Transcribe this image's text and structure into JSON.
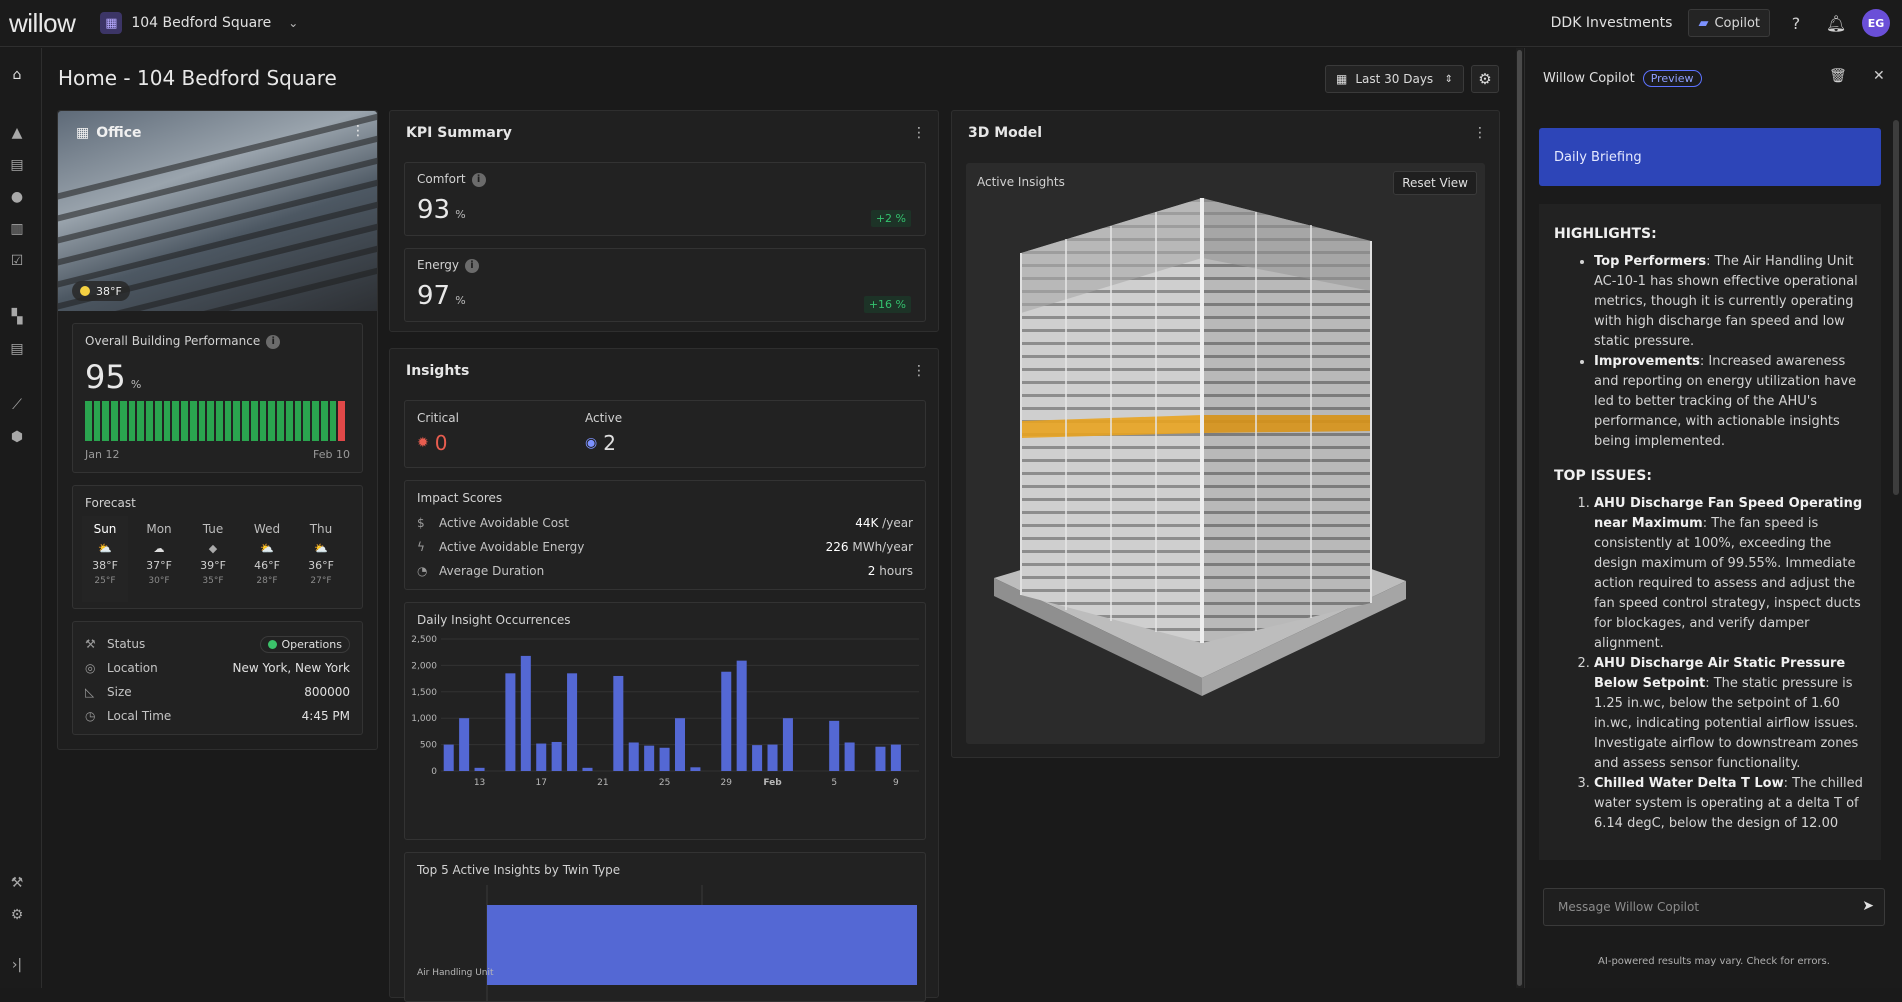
{
  "topbar": {
    "logo": "willow",
    "site_name": "104 Bedford Square",
    "org_name": "DDK Investments",
    "copilot_label": "Copilot",
    "avatar_initials": "EG"
  },
  "page": {
    "title": "Home - 104 Bedford Square",
    "date_range": "Last 30 Days"
  },
  "building": {
    "type_label": "Office",
    "temperature": "38°F",
    "performance_label": "Overall Building Performance",
    "performance_value": "95",
    "performance_unit": "%",
    "start_date": "Jan 12",
    "end_date": "Feb 10",
    "forecast_label": "Forecast",
    "forecast": [
      {
        "day": "Sun",
        "weather": "⛅",
        "hi": "38°F",
        "lo": "25°F"
      },
      {
        "day": "Mon",
        "weather": "☁",
        "hi": "37°F",
        "lo": "30°F"
      },
      {
        "day": "Tue",
        "weather": "◆",
        "hi": "39°F",
        "lo": "35°F"
      },
      {
        "day": "Wed",
        "weather": "⛅",
        "hi": "46°F",
        "lo": "28°F"
      },
      {
        "day": "Thu",
        "weather": "⛅",
        "hi": "36°F",
        "lo": "27°F"
      }
    ],
    "details": {
      "status_label": "Status",
      "status_value": "Operations",
      "location_label": "Location",
      "location_value": "New York, New York",
      "size_label": "Size",
      "size_value": "800000",
      "time_label": "Local Time",
      "time_value": "4:45 PM"
    }
  },
  "kpi": {
    "title": "KPI Summary",
    "comfort_label": "Comfort",
    "comfort_value": "93",
    "comfort_unit": "%",
    "comfort_delta": "+2 %",
    "energy_label": "Energy",
    "energy_value": "97",
    "energy_unit": "%",
    "energy_delta": "+16 %"
  },
  "insights": {
    "title": "Insights",
    "critical_label": "Critical",
    "critical_value": "0",
    "active_label": "Active",
    "active_value": "2",
    "impact_label": "Impact Scores",
    "cost_label": "Active Avoidable Cost",
    "cost_value": "44K",
    "cost_unit": "/year",
    "energy_label": "Active Avoidable Energy",
    "energy_value": "226",
    "energy_unit": "MWh/year",
    "duration_label": "Average Duration",
    "duration_value": "2",
    "duration_unit": "hours",
    "daily_title": "Daily Insight Occurrences",
    "top5_title": "Top 5 Active Insights by Twin Type",
    "top5_category": "Air Handling Unit"
  },
  "chart_data": [
    {
      "type": "bar",
      "title": "Daily Insight Occurrences",
      "x_tick_labels": [
        "13",
        "17",
        "21",
        "25",
        "29",
        "Feb",
        "5",
        "9"
      ],
      "x_tick_positions": [
        13,
        17,
        21,
        25,
        29,
        32,
        36,
        40
      ],
      "y_tick_labels": [
        "0",
        "500",
        "1,000",
        "1,500",
        "2,000",
        "2,500"
      ],
      "ylim": [
        0,
        2500
      ],
      "x": [
        11,
        12,
        13,
        14,
        15,
        16,
        17,
        18,
        19,
        20,
        21,
        22,
        23,
        24,
        25,
        26,
        27,
        28,
        29,
        30,
        31,
        32,
        33,
        34,
        35,
        36,
        37,
        38,
        39,
        40,
        41
      ],
      "values": [
        500,
        1000,
        60,
        0,
        1850,
        2180,
        520,
        550,
        1850,
        60,
        0,
        1800,
        540,
        480,
        440,
        1000,
        70,
        0,
        1880,
        2090,
        490,
        500,
        1000,
        0,
        0,
        950,
        540,
        0,
        460,
        500,
        0
      ]
    },
    {
      "type": "bar",
      "title": "Top 5 Active Insights by Twin Type",
      "categories": [
        "Air Handling Unit"
      ],
      "values": [
        2
      ],
      "xlim": [
        0,
        2
      ]
    }
  ],
  "model3d": {
    "title": "3D Model",
    "active_insights_label": "Active Insights",
    "reset_label": "Reset View"
  },
  "copilot": {
    "title": "Willow Copilot",
    "badge": "Preview",
    "briefing": "Daily Briefing",
    "highlights_heading": "HIGHLIGHTS:",
    "highlights": [
      {
        "bold": "Top Performers",
        "text": ": The Air Handling Unit AC-10-1 has shown effective operational metrics, though it is currently operating with high discharge fan speed and low static pressure."
      },
      {
        "bold": "Improvements",
        "text": ": Increased awareness and reporting on energy utilization have led to better tracking of the AHU's performance, with actionable insights being implemented."
      }
    ],
    "issues_heading": "TOP ISSUES:",
    "issues": [
      {
        "bold": "AHU Discharge Fan Speed Operating near Maximum",
        "text": ": The fan speed is consistently at 100%, exceeding the design maximum of 99.55%. Immediate action required to assess and adjust the fan speed control strategy, inspect ducts for blockages, and verify damper alignment."
      },
      {
        "bold": "AHU Discharge Air Static Pressure Below Setpoint",
        "text": ": The static pressure is 1.25 in.wc, below the setpoint of 1.60 in.wc, indicating potential airflow issues. Investigate airflow to downstream zones and assess sensor functionality."
      },
      {
        "bold": "Chilled Water Delta T Low",
        "text": ": The chilled water system is operating at a delta T of 6.14 degC, below the design of 12.00"
      }
    ],
    "input_placeholder": "Message Willow Copilot",
    "disclaimer": "AI-powered results may vary. Check for errors."
  }
}
